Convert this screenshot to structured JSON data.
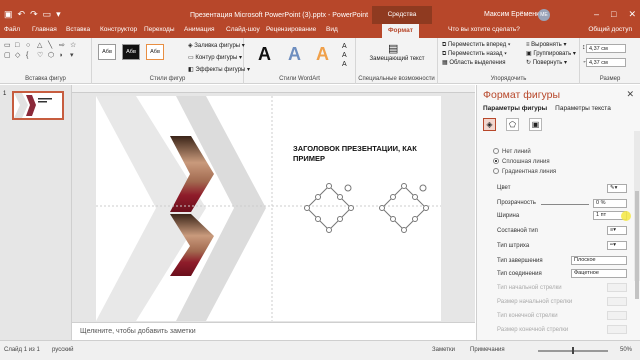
{
  "title_bar": {
    "doc_title": "Презентация Microsoft PowerPoint (3).pptx  -  PowerPoint",
    "contextual": "Средства рисования",
    "user": "Максим Ерёменко",
    "avatar": "МЕ",
    "window_controls": [
      "–",
      "□",
      "✕"
    ],
    "accent": "#b7472a"
  },
  "tabs": {
    "file": "Файл",
    "home": "Главная",
    "insert": "Вставка",
    "designer": "Конструктор",
    "transitions": "Переходы",
    "animations": "Анимация",
    "slideshow": "Слайд-шоу",
    "review": "Рецензирование",
    "view": "Вид",
    "format": "Формат",
    "help": "Что вы хотите сделать?",
    "share": "Общий доступ"
  },
  "ribbon": {
    "insert_shapes": "Вставка фигур",
    "shape_styles": "Стили фигур",
    "style_sample": "Абв",
    "fill": "Заливка фигуры",
    "outline": "Контур фигуры",
    "effects": "Эффекты фигуры",
    "wordart_letter": "A",
    "wordart_styles": "Стили WordArt",
    "alt_text": "Замещающий текст",
    "accessibility": "Специальные возможности",
    "bring_forward": "Переместить вперед",
    "send_backward": "Переместить назад",
    "selection_pane": "Область выделения",
    "align": "Выровнять",
    "group": "Группировать",
    "rotate": "Повернуть",
    "arrange": "Упорядочить",
    "height": "4,37 см",
    "width": "4,37 см",
    "size": "Размер"
  },
  "slides_panel": {
    "slide_number": "1"
  },
  "slide": {
    "title": "ЗАГОЛОВОК ПРЕЗЕНТАЦИИ, КАК ПРИМЕР"
  },
  "notes_placeholder": "Щелкните, чтобы добавить заметки",
  "format_pane": {
    "title": "Формат фигуры",
    "close": "✕",
    "tab_shape": "Параметры фигуры",
    "tab_text": "Параметры текста",
    "no_line": "Нет линий",
    "solid_line": "Сплошная линия",
    "gradient_line": "Градиентная линия",
    "color": "Цвет",
    "transparency": "Прозрачность",
    "transparency_value": "0 %",
    "width": "Ширина",
    "width_value": "1 пт",
    "compound": "Составной тип",
    "dash": "Тип штриха",
    "cap": "Тип завершения",
    "cap_value": "Плоское",
    "join": "Тип соединения",
    "join_value": "Фацетное",
    "begin_arrow": "Тип начальной стрелки",
    "begin_size": "Размер начальной стрелки",
    "end_arrow": "Тип конечной стрелки",
    "end_size": "Размер конечной стрелки"
  },
  "status": {
    "slide_of": "Слайд 1 из 1",
    "language": "русский",
    "notes": "Заметки",
    "comments": "Примечания",
    "zoom": "50%"
  }
}
